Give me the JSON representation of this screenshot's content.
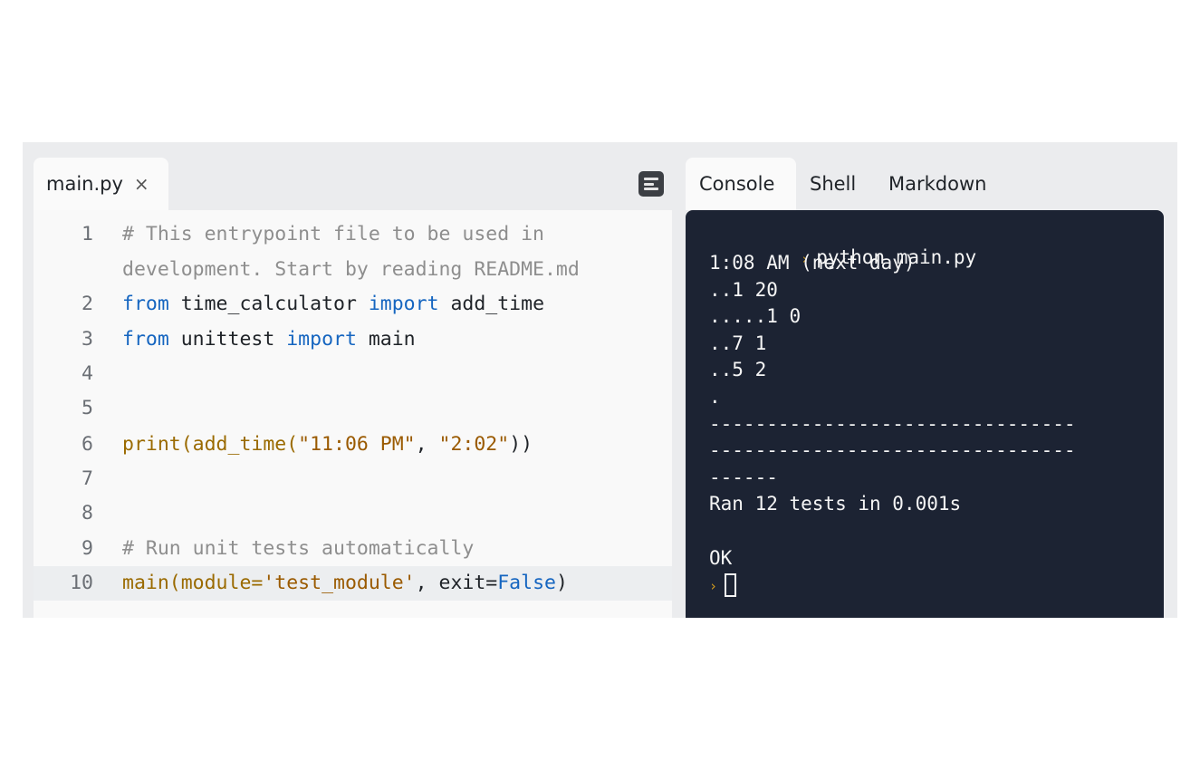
{
  "editor": {
    "tab": {
      "label": "main.py",
      "close_icon": "×"
    },
    "layout_button": "layout-icon",
    "lines": [
      {
        "num": "1",
        "tokens": [
          {
            "t": "# This entrypoint file to be used in",
            "c": "cmt"
          }
        ]
      },
      {
        "num": "",
        "tokens": [
          {
            "t": "development. Start by reading README.md",
            "c": "cmt"
          }
        ]
      },
      {
        "num": "2",
        "tokens": [
          {
            "t": "from",
            "c": "kw"
          },
          {
            "t": " time_calculator ",
            "c": ""
          },
          {
            "t": "import",
            "c": "kw"
          },
          {
            "t": " add_time",
            "c": ""
          }
        ]
      },
      {
        "num": "3",
        "tokens": [
          {
            "t": "from",
            "c": "kw"
          },
          {
            "t": " unittest ",
            "c": ""
          },
          {
            "t": "import",
            "c": "kw"
          },
          {
            "t": " main",
            "c": ""
          }
        ]
      },
      {
        "num": "4",
        "tokens": []
      },
      {
        "num": "5",
        "tokens": []
      },
      {
        "num": "6",
        "tokens": [
          {
            "t": "print(add_time(",
            "c": "fn"
          },
          {
            "t": "\"11:06 PM\"",
            "c": "str"
          },
          {
            "t": ", ",
            "c": ""
          },
          {
            "t": "\"2:02\"",
            "c": "str"
          },
          {
            "t": "))",
            "c": ""
          }
        ]
      },
      {
        "num": "7",
        "tokens": []
      },
      {
        "num": "8",
        "tokens": []
      },
      {
        "num": "9",
        "tokens": [
          {
            "t": "# Run unit tests automatically",
            "c": "cmt"
          }
        ]
      },
      {
        "num": "10",
        "tokens": [
          {
            "t": "main(module=",
            "c": "fn"
          },
          {
            "t": "'test_module'",
            "c": "str"
          },
          {
            "t": ", exit=",
            "c": ""
          },
          {
            "t": "False",
            "c": "const"
          },
          {
            "t": ")",
            "c": ""
          }
        ],
        "active": true
      }
    ]
  },
  "console": {
    "tabs": [
      "Console",
      "Shell",
      "Markdown"
    ],
    "active_tab": "Console",
    "command": "python main.py",
    "output": [
      "1:08 AM (next day)",
      "..1 20",
      ".....1 0",
      "..7 1",
      "..5 2",
      ".",
      "--------------------------------",
      "--------------------------------",
      "------",
      "Ran 12 tests in 0.001s",
      "",
      "OK"
    ],
    "prompt_icon": "›"
  }
}
